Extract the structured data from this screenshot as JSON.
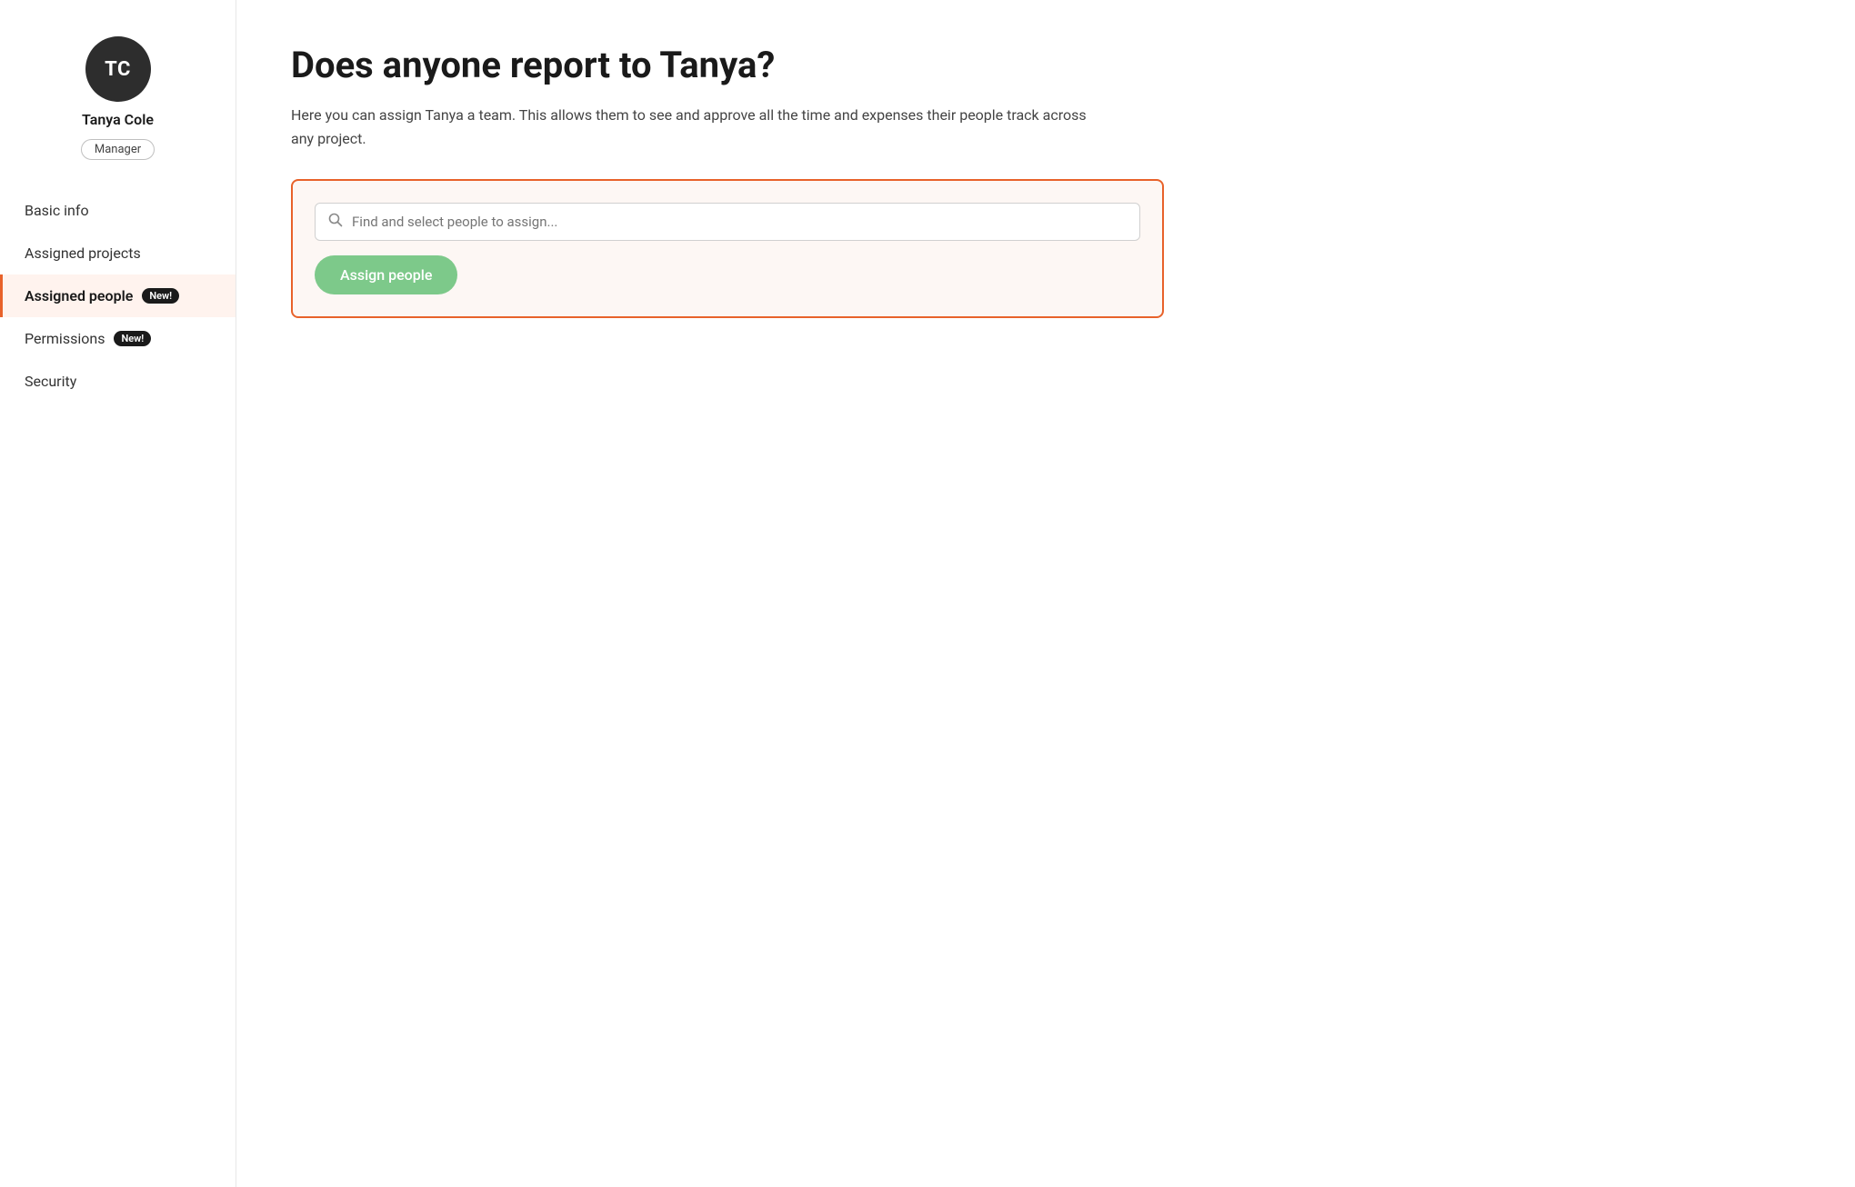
{
  "sidebar": {
    "user": {
      "initials": "TC",
      "name": "Tanya Cole",
      "role": "Manager"
    },
    "nav_items": [
      {
        "id": "basic-info",
        "label": "Basic info",
        "active": false,
        "badge": null
      },
      {
        "id": "assigned-projects",
        "label": "Assigned projects",
        "active": false,
        "badge": null
      },
      {
        "id": "assigned-people",
        "label": "Assigned people",
        "active": true,
        "badge": "New!"
      },
      {
        "id": "permissions",
        "label": "Permissions",
        "active": false,
        "badge": "New!"
      },
      {
        "id": "security",
        "label": "Security",
        "active": false,
        "badge": null
      }
    ]
  },
  "main": {
    "title": "Does anyone report to Tanya?",
    "description": "Here you can assign Tanya a team. This allows them to see and approve all the time and expenses their people track across any project.",
    "search_placeholder": "Find and select people to assign...",
    "assign_button_label": "Assign people"
  }
}
